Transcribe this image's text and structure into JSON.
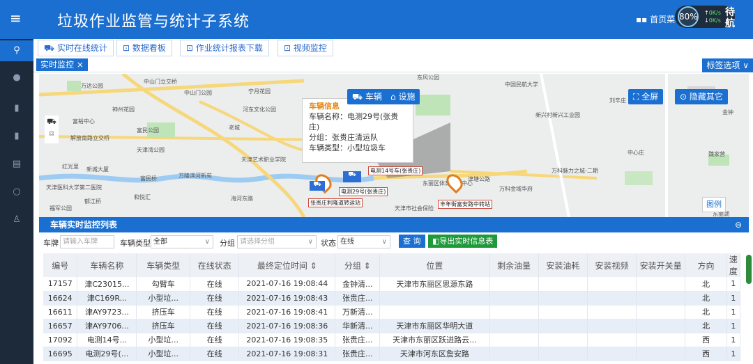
{
  "header": {
    "menu_icon": "menu-icon",
    "title": "垃圾作业监管与统计子系统",
    "home_menu": "首页菜单",
    "speed": {
      "percent": "80%",
      "up": "0K/s",
      "down": "0K/s"
    },
    "extra": "待\n航"
  },
  "topnav": [
    {
      "label": "实时在线统计"
    },
    {
      "label": "数据看板"
    },
    {
      "label": "作业统计报表下载"
    },
    {
      "label": "视频监控"
    }
  ],
  "tabs": {
    "active": "实时监控",
    "tag_options": "标签选项"
  },
  "map": {
    "buttons": {
      "vehicle": "车辆",
      "facility": "设施",
      "fullscreen": "全屏",
      "hide_others": "隐藏其它"
    },
    "popup": {
      "title": "车辆信息",
      "name": "车辆名称：电测29号(张贵庄)",
      "group": "分组：张贵庄清运队",
      "type": "车辆类型：小型垃圾车"
    },
    "tags": [
      "电测14号车(张贵庄)",
      "电测29号(张贵庄)",
      "张贵庄利隆道转运站",
      "丰年街富安路中转站"
    ],
    "legend": "图例",
    "places": [
      "中山门立交桥",
      "万达公园",
      "中山门公园",
      "宁月花园",
      "神州花园",
      "富裕中心",
      "富民公园",
      "解放南路立交桥",
      "天津湾公园",
      "红光里",
      "新城大厦",
      "天津医科大学第二医院",
      "富民桥",
      "万隆滨河新苑",
      "天津艺术职业学院",
      "海河东路",
      "郁江桥",
      "和悦汇",
      "福军公园",
      "东丽区体育运动中心",
      "万科金域华府",
      "万科魅力之城-二期",
      "中国民航大学",
      "新兴村新兴工业园",
      "天津市社会保险",
      "津塘公路",
      "中心庄",
      "魏家营",
      "金钟",
      "东丽湖",
      "老城",
      "河东文化公园",
      "刘辛庄",
      "东风公园"
    ]
  },
  "panel": {
    "title": "车辆实时监控列表",
    "collapse": "⊖"
  },
  "filters": {
    "plate_label": "车牌",
    "plate_placeholder": "请输入车牌",
    "type_label": "车辆类型",
    "type_value": "全部",
    "group_label": "分组",
    "group_placeholder": "请选择分组",
    "status_label": "状态",
    "status_value": "在线",
    "query": "查 询",
    "export": "导出实时信息表"
  },
  "table": {
    "headers": [
      "编号",
      "车辆名称",
      "车辆类型",
      "在线状态",
      "最终定位时间 ⇕",
      "分组 ⇕",
      "位置",
      "剩余油量",
      "安装油耗",
      "安装视频",
      "安装开关量",
      "方向",
      "速度"
    ],
    "rows": [
      [
        "17157",
        "津C23015...",
        "勾臂车",
        "在线",
        "2021-07-16 19:08:44",
        "金钟清...",
        "天津市东丽区思源东路",
        "",
        "",
        "",
        "",
        "北",
        "1"
      ],
      [
        "16624",
        "津C169R...",
        "小型垃...",
        "在线",
        "2021-07-16 19:08:43",
        "张贵庄...",
        "",
        "",
        "",
        "",
        "",
        "北",
        "1"
      ],
      [
        "16611",
        "津AY9723...",
        "挤压车",
        "在线",
        "2021-07-16 19:08:41",
        "万新清...",
        "",
        "",
        "",
        "",
        "",
        "北",
        "1"
      ],
      [
        "16657",
        "津AY9706...",
        "挤压车",
        "在线",
        "2021-07-16 19:08:36",
        "华新清...",
        "天津市东丽区华明大道",
        "",
        "",
        "",
        "",
        "北",
        "1"
      ],
      [
        "17092",
        "电测14号...",
        "小型垃...",
        "在线",
        "2021-07-16 19:08:35",
        "张贵庄...",
        "天津市东丽区跃进路云...",
        "",
        "",
        "",
        "",
        "西",
        "1"
      ],
      [
        "16695",
        "电测29号(...",
        "小型垃...",
        "在线",
        "2021-07-16 19:08:31",
        "张贵庄...",
        "天津市河东区詹安路",
        "",
        "",
        "",
        "",
        "西",
        "1"
      ]
    ]
  }
}
